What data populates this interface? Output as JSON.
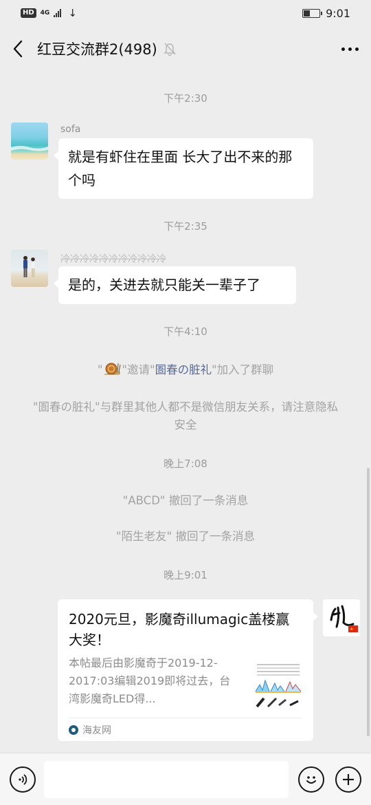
{
  "status_bar": {
    "hd": "HD",
    "network": "4G",
    "time": "9:01"
  },
  "header": {
    "title": "红豆交流群2(498)"
  },
  "messages": {
    "time_1": "下午2:30",
    "msg1": {
      "sender": "sofa",
      "text": "就是有虾住在里面 长大了出不来的那个吗"
    },
    "time_2": "下午2:35",
    "msg2": {
      "sender": "冷冷冷冷冷冷冷冷冷冷冷",
      "text": "是的，关进去就只能关一辈子了"
    },
    "time_3": "下午4:10",
    "invite": {
      "prefix": "\"",
      "mid": "\"邀请\"",
      "invitee": "圄春の脏礼",
      "suffix": "\"加入了群聊"
    },
    "privacy_notice": "\"圄春の脏礼\"与群里其他人都不是微信朋友关系，请注意隐私安全",
    "time_4": "晚上7:08",
    "recall_1": "\"ABCD\" 撤回了一条消息",
    "recall_2": "\"陌生老友\" 撤回了一条消息",
    "time_5": "晚上9:01",
    "link_card": {
      "title": "2020元旦，影魔奇illumagic盖楼赢大奖！",
      "description": "本帖最后由影魔奇于2019-12-2017:03编辑2019即将过去，台湾影魔奇LED得...",
      "source": "海友网"
    }
  },
  "input_bar": {
    "placeholder": ""
  },
  "icons": {
    "back": "back-arrow-icon",
    "mute": "mute-bell-icon",
    "more": "more-dots-icon",
    "voice": "voice-icon",
    "emoji": "emoji-icon",
    "plus": "plus-icon"
  }
}
